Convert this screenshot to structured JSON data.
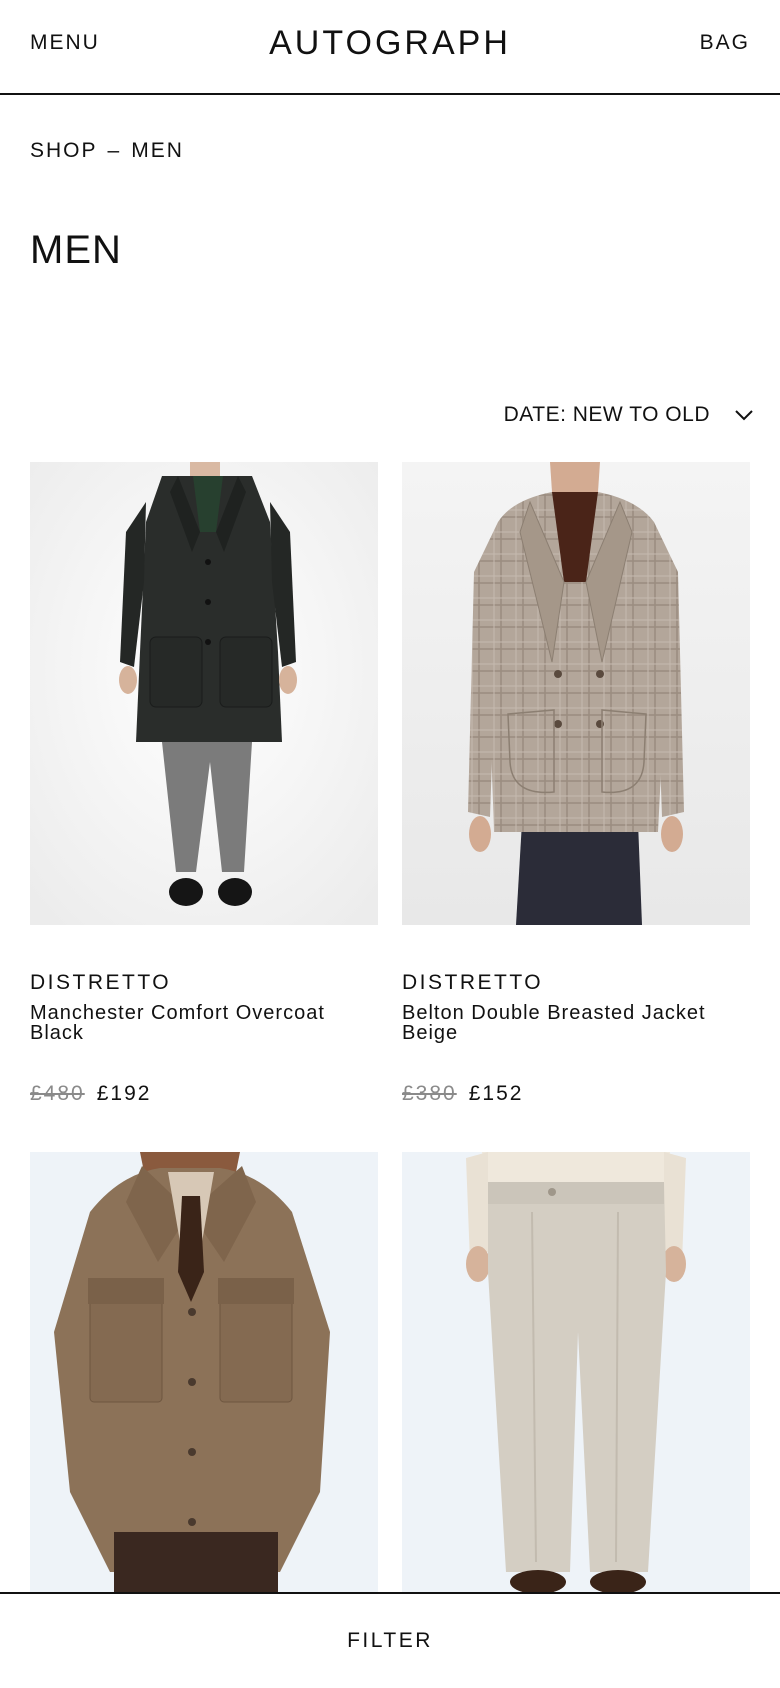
{
  "header": {
    "menu_label": "MENU",
    "logo_text": "AUTOGRAPH",
    "bag_label": "BAG"
  },
  "breadcrumb": {
    "items": [
      "SHOP",
      "MEN"
    ],
    "separator": "–"
  },
  "page_title": "MEN",
  "sort": {
    "selected": "DATE: NEW TO OLD",
    "icon": "chevron-down-icon"
  },
  "products": [
    {
      "brand": "DISTRETTO",
      "name": "Manchester Comfort Overcoat Black",
      "price_was": "£480",
      "price_now": "£192"
    },
    {
      "brand": "DISTRETTO",
      "name": "Belton Double Breasted Jacket Beige",
      "price_was": "£380",
      "price_now": "£152"
    },
    {
      "brand": "",
      "name": "",
      "price_was": "",
      "price_now": ""
    },
    {
      "brand": "",
      "name": "",
      "price_was": "",
      "price_now": ""
    }
  ],
  "filter_bar": {
    "label": "FILTER"
  },
  "colors": {
    "text": "#111111",
    "strikethrough_price": "#8a8a8a",
    "background": "#ffffff"
  }
}
